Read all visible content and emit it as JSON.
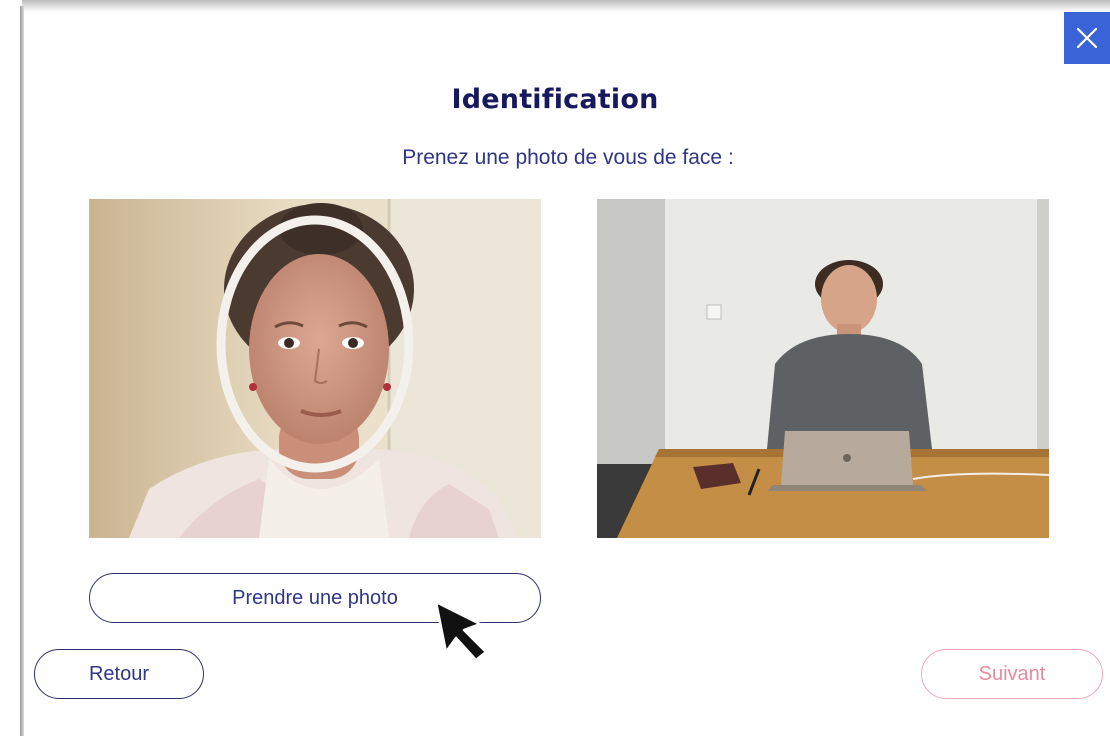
{
  "dialog": {
    "title": "Identification",
    "subtitle": "Prenez une photo de vous de face :"
  },
  "close_icon": "close-icon",
  "images": {
    "selfie": "selfie-photo-with-face-oval-guide",
    "context": "person-at-laptop-photo"
  },
  "buttons": {
    "take_photo": "Prendre une photo",
    "back": "Retour",
    "next": "Suivant"
  },
  "colors": {
    "title": "#17195e",
    "text": "#2f3688",
    "close_bg": "#3a63d8",
    "next_disabled": "#e98a9b"
  }
}
